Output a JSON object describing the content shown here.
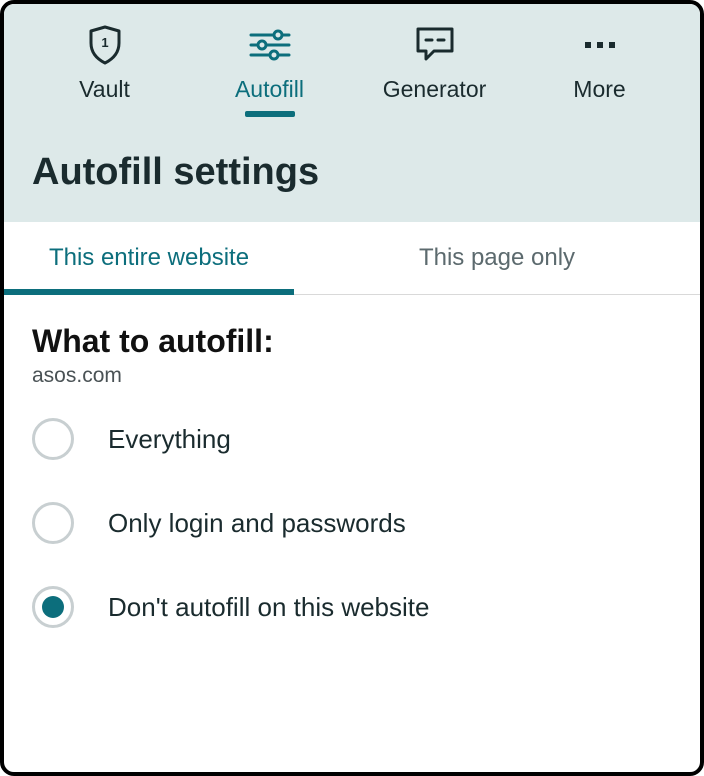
{
  "nav": {
    "items": [
      {
        "id": "vault",
        "label": "Vault"
      },
      {
        "id": "autofill",
        "label": "Autofill"
      },
      {
        "id": "generator",
        "label": "Generator"
      },
      {
        "id": "more",
        "label": "More"
      }
    ],
    "activeId": "autofill"
  },
  "title": "Autofill settings",
  "scope": {
    "tabs": [
      {
        "id": "website",
        "label": "This entire website"
      },
      {
        "id": "page",
        "label": "This page only"
      }
    ],
    "activeId": "website"
  },
  "section": {
    "title": "What to autofill:",
    "domain": "asos.com"
  },
  "options": [
    {
      "id": "everything",
      "label": "Everything",
      "selected": false
    },
    {
      "id": "login-only",
      "label": "Only login and passwords",
      "selected": false
    },
    {
      "id": "none",
      "label": "Don't autofill on this website",
      "selected": true
    }
  ]
}
